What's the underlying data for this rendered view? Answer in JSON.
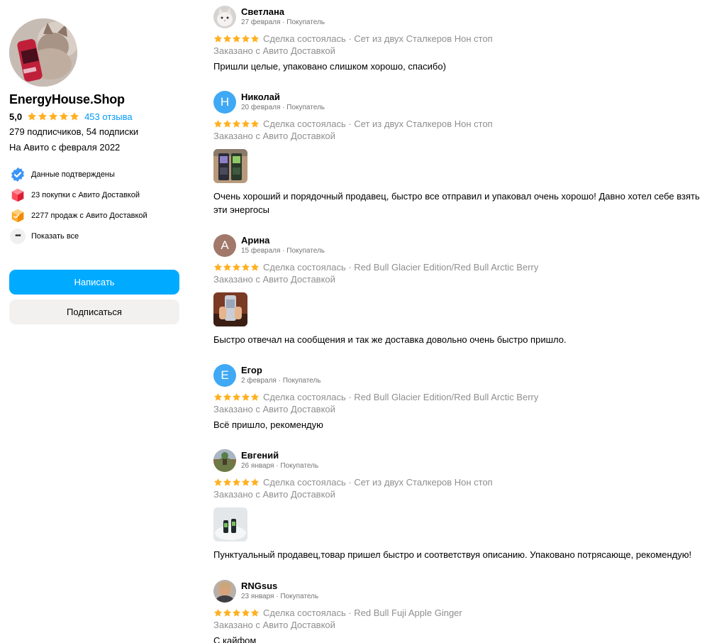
{
  "seller": {
    "name": "EnergyHouse.Shop",
    "rating": "5,0",
    "reviews_link": "453 отзыва",
    "followers": "279 подписчиков, 54 подписки",
    "since": "На Авито с февраля 2022",
    "badges": [
      {
        "icon": "verified-check-icon",
        "label": "Данные подтверждены"
      },
      {
        "icon": "delivery-box-icon",
        "label": "23 покупки с Авито Доставкой"
      },
      {
        "icon": "sales-box-icon",
        "label": "2277 продаж с Авито Доставкой"
      },
      {
        "icon": "more-dots-icon",
        "label": "Показать все"
      }
    ],
    "write_button": "Написать",
    "subscribe_button": "Подписаться"
  },
  "colors": {
    "accent": "#00aaff",
    "link": "#0099f7",
    "star": "#ffb021",
    "muted": "#8f8f8f"
  },
  "reviews": [
    {
      "author": "Светлана",
      "avatar": "cat-photo",
      "meta": "27 февраля · Покупатель",
      "deal": "Сделка состоялась · Сет из двух Сталкеров Нон стоп",
      "order": "Заказано с Авито Доставкой",
      "text": "Пришли целые, упаковано слишком хорошо, спасибо)"
    },
    {
      "author": "Николай",
      "avatar_letter": "Н",
      "avatar_color": "#3fa9f5",
      "meta": "20 февраля · Покупатель",
      "deal": "Сделка состоялась · Сет из двух Сталкеров Нон стоп",
      "order": "Заказано с Авито Доставкой",
      "text": "Очень хороший и порядочный продавец, быстро все отправил и упаковал очень хорошо! Давно хотел себе взять эти энергосы"
    },
    {
      "author": "Арина",
      "avatar_letter": "А",
      "avatar_color": "#a1786a",
      "meta": "15 февраля · Покупатель",
      "deal": "Сделка состоялась · Red Bull Glacier Edition/Red Bull Arctic Berry",
      "order": "Заказано с Авито Доставкой",
      "text": "Быстро отвечал на сообщения и так же доставка довольно очень быстро пришло."
    },
    {
      "author": "Егор",
      "avatar_letter": "Е",
      "avatar_color": "#3fa9f5",
      "meta": "2 февраля · Покупатель",
      "deal": "Сделка состоялась · Red Bull Glacier Edition/Red Bull Arctic Berry",
      "order": "Заказано с Авито Доставкой",
      "text": "Всё пришло, рекомендую"
    },
    {
      "author": "Евгений",
      "avatar": "landscape-photo",
      "meta": "26 января · Покупатель",
      "deal": "Сделка состоялась · Сет из двух Сталкеров Нон стоп",
      "order": "Заказано с Авито Доставкой",
      "text": "Пунктуальный продавец,товар пришел быстро и соответствуя описанию. Упаковано потрясающе, рекомендую!"
    },
    {
      "author": "RNGsus",
      "avatar": "person-photo",
      "meta": "23 января · Покупатель",
      "deal": "Сделка состоялась · Red Bull Fuji Apple Ginger",
      "order": "Заказано с Авито Доставкой",
      "text": "С кайфом"
    }
  ]
}
